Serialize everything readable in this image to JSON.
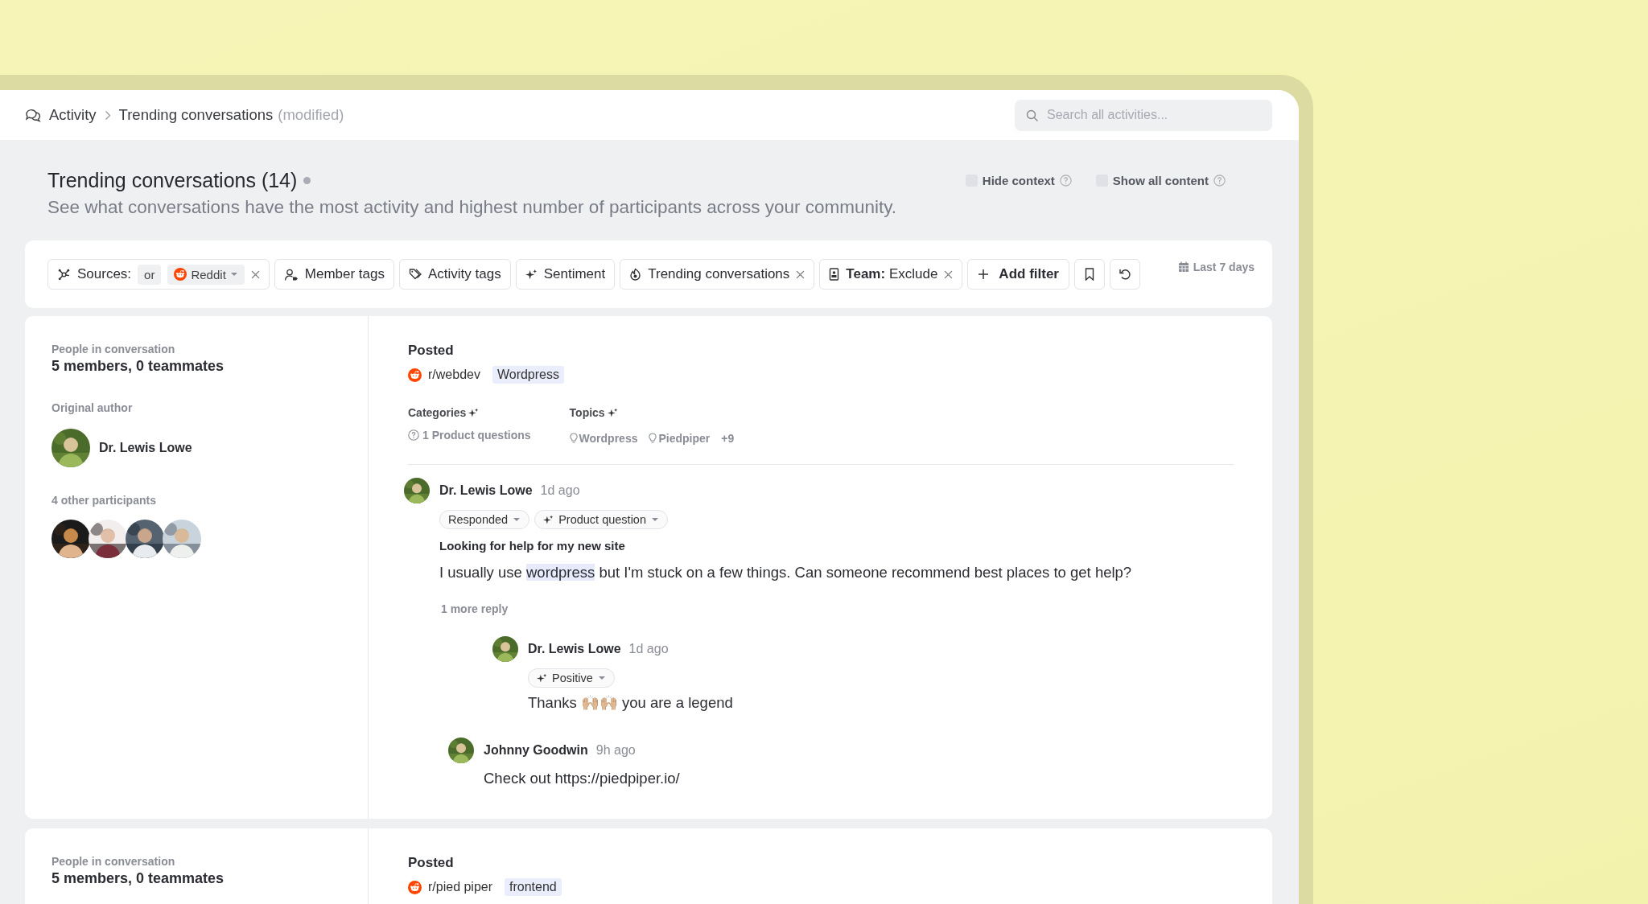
{
  "breadcrumb": {
    "section": "Activity",
    "page": "Trending conversations",
    "note": "(modified)"
  },
  "search": {
    "placeholder": "Search all activities..."
  },
  "header": {
    "title": "Trending conversations (14)",
    "subtitle": "See what conversations have the most activity and highest number of participants across your community.",
    "options": [
      {
        "label": "Hide context",
        "checked": false
      },
      {
        "label": "Show all content",
        "checked": false
      }
    ]
  },
  "filters": [
    {
      "kind": "sources",
      "label": "Sources:",
      "operator": "or",
      "value": "Reddit",
      "removable": true
    },
    {
      "kind": "member",
      "label": "Member tags",
      "removable": false
    },
    {
      "kind": "activity",
      "label": "Activity tags",
      "removable": false
    },
    {
      "kind": "sentiment",
      "label": "Sentiment",
      "removable": false
    },
    {
      "kind": "trending",
      "label": "Trending conversations",
      "removable": true
    },
    {
      "kind": "team",
      "label": "Team:",
      "value": "Exclude",
      "removable": true
    },
    {
      "kind": "add",
      "label": "Add filter",
      "removable": false
    }
  ],
  "date_range": "Last 7 days",
  "conversations": [
    {
      "people_label": "People in conversation",
      "people": "5 members, 0 teammates",
      "author_label": "Original author",
      "author": "Dr. Lewis Lowe",
      "participants_label": "4 other participants",
      "participants": [
        {
          "kind": "picture"
        },
        {
          "kind": "picture"
        },
        {
          "kind": "picture"
        },
        {
          "kind": "picture"
        }
      ],
      "posted_label": "Posted",
      "source": "r/webdev",
      "tag": "Wordpress",
      "categories_label": "Categories",
      "categories": [
        "1 Product questions"
      ],
      "topics_label": "Topics",
      "topics": [
        "Wordpress",
        "Piedpiper"
      ],
      "topics_more": "+9",
      "messages": [
        {
          "kind": "message",
          "author": "Dr. Lewis Lowe",
          "time": "1d ago",
          "tags": [
            {
              "kind": "status",
              "label": "Responded"
            },
            {
              "kind": "ai",
              "label": "Product question"
            }
          ],
          "title": "Looking for help for my new site",
          "body": [
            {
              "text": "I usually use ",
              "highlighted": false
            },
            {
              "text": "wordpress",
              "highlighted": true
            },
            {
              "text": " but I'm stuck on a few things. Can someone recommend best places to get help?",
              "highlighted": false
            }
          ],
          "replies": [
            {
              "kind": "collapsed",
              "label": "1 more reply",
              "replies": [
                {
                  "kind": "message",
                  "author": "Dr. Lewis Lowe",
                  "time": "1d ago",
                  "tags": [
                    {
                      "kind": "ai",
                      "label": "Positive"
                    }
                  ],
                  "body": [
                    {
                      "text": "Thanks 🙌🏼🙌🏼 you are a legend",
                      "highlighted": false
                    }
                  ]
                }
              ]
            },
            {
              "kind": "message",
              "author": "Johnny Goodwin",
              "time": "9h ago",
              "body": [
                {
                  "text": "Check out https://piedpiper.io/",
                  "highlighted": false
                }
              ]
            }
          ]
        }
      ]
    },
    {
      "people_label": "People in conversation",
      "people": "5 members, 0 teammates",
      "posted_label": "Posted",
      "source": "r/pied piper",
      "tag": "frontend"
    }
  ]
}
